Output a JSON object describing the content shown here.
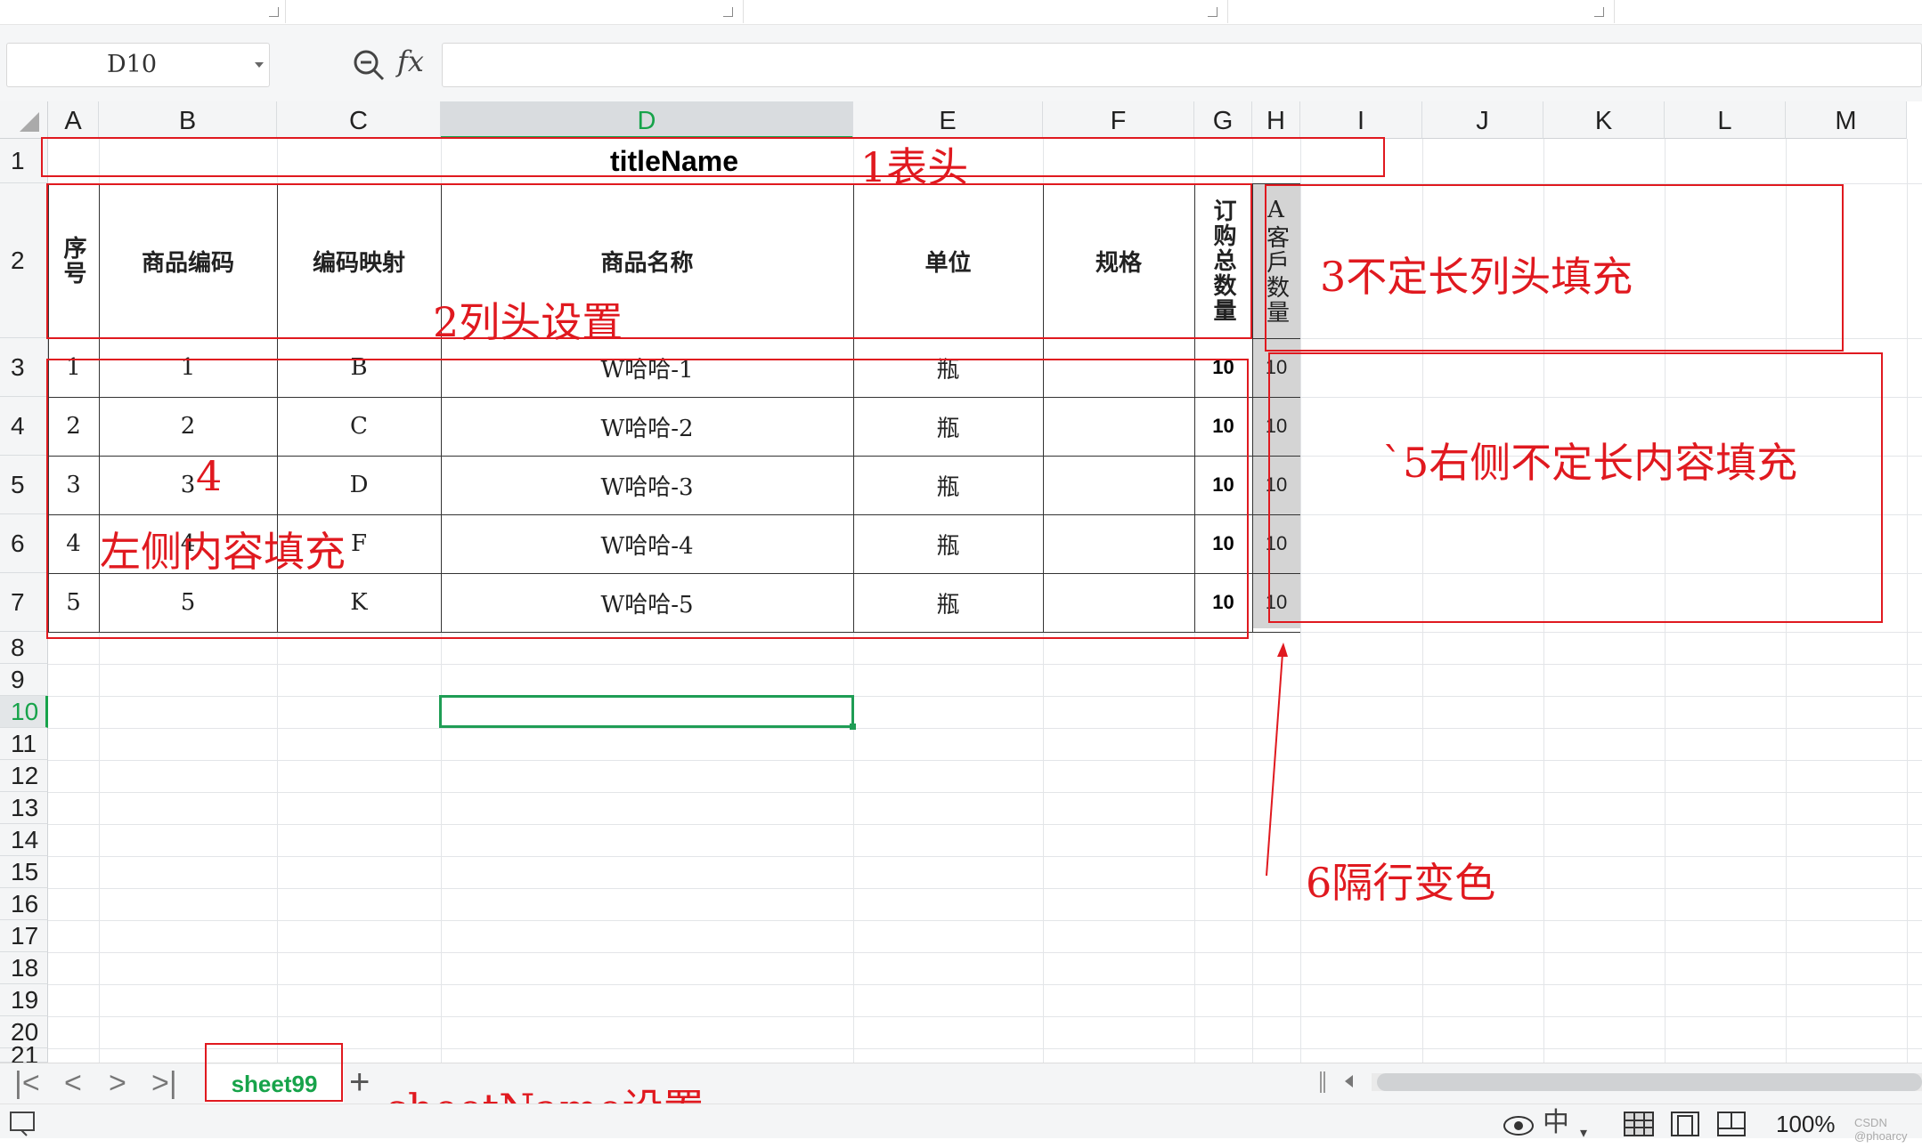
{
  "formula_bar": {
    "cell_ref": "D10",
    "fx_label": "fx",
    "formula": ""
  },
  "columns": [
    "A",
    "B",
    "C",
    "D",
    "E",
    "F",
    "G",
    "H",
    "I",
    "J",
    "K",
    "L",
    "M"
  ],
  "selected_column": "D",
  "rows": [
    "1",
    "2",
    "3",
    "4",
    "5",
    "6",
    "7",
    "8",
    "9",
    "10",
    "11",
    "12",
    "13",
    "14",
    "15",
    "16",
    "17",
    "18",
    "19",
    "20",
    "21"
  ],
  "selected_row": "10",
  "table": {
    "title": "titleName",
    "headers": [
      "序号",
      "商品编码",
      "编码映射",
      "商品名称",
      "单位",
      "规格",
      "订购总数量",
      "A客戶数量"
    ],
    "rows": [
      {
        "seq": "1",
        "code": "1",
        "map": "B",
        "name": "W哈哈-1",
        "unit": "瓶",
        "spec": "",
        "total": "10",
        "a_qty": "10"
      },
      {
        "seq": "2",
        "code": "2",
        "map": "C",
        "name": "W哈哈-2",
        "unit": "瓶",
        "spec": "",
        "total": "10",
        "a_qty": "10"
      },
      {
        "seq": "3",
        "code": "3",
        "map": "D",
        "name": "W哈哈-3",
        "unit": "瓶",
        "spec": "",
        "total": "10",
        "a_qty": "10"
      },
      {
        "seq": "4",
        "code": "4",
        "map": "F",
        "name": "W哈哈-4",
        "unit": "瓶",
        "spec": "",
        "total": "10",
        "a_qty": "10"
      },
      {
        "seq": "5",
        "code": "5",
        "map": "K",
        "name": "W哈哈-5",
        "unit": "瓶",
        "spec": "",
        "total": "10",
        "a_qty": "10"
      }
    ]
  },
  "annotations": {
    "header": "1表头",
    "col_header": "2列头设置",
    "dynamic_col_header": "3不定长列头填充",
    "left_label_num": "4",
    "left_label": "左侧内容填充",
    "right_content": "`5右侧不定长内容填充",
    "row_color": "6隔行变色",
    "sheet_name": "sheetName设置"
  },
  "sheet_tabs": {
    "active": "sheet99",
    "add_label": "+"
  },
  "status_bar": {
    "zoom": "100%",
    "watermark": "CSDN @phoarcy"
  },
  "colors": {
    "accent_green": "#17a34a",
    "annotation_red": "#e0191f",
    "band_gray": "#d4d4d4"
  }
}
